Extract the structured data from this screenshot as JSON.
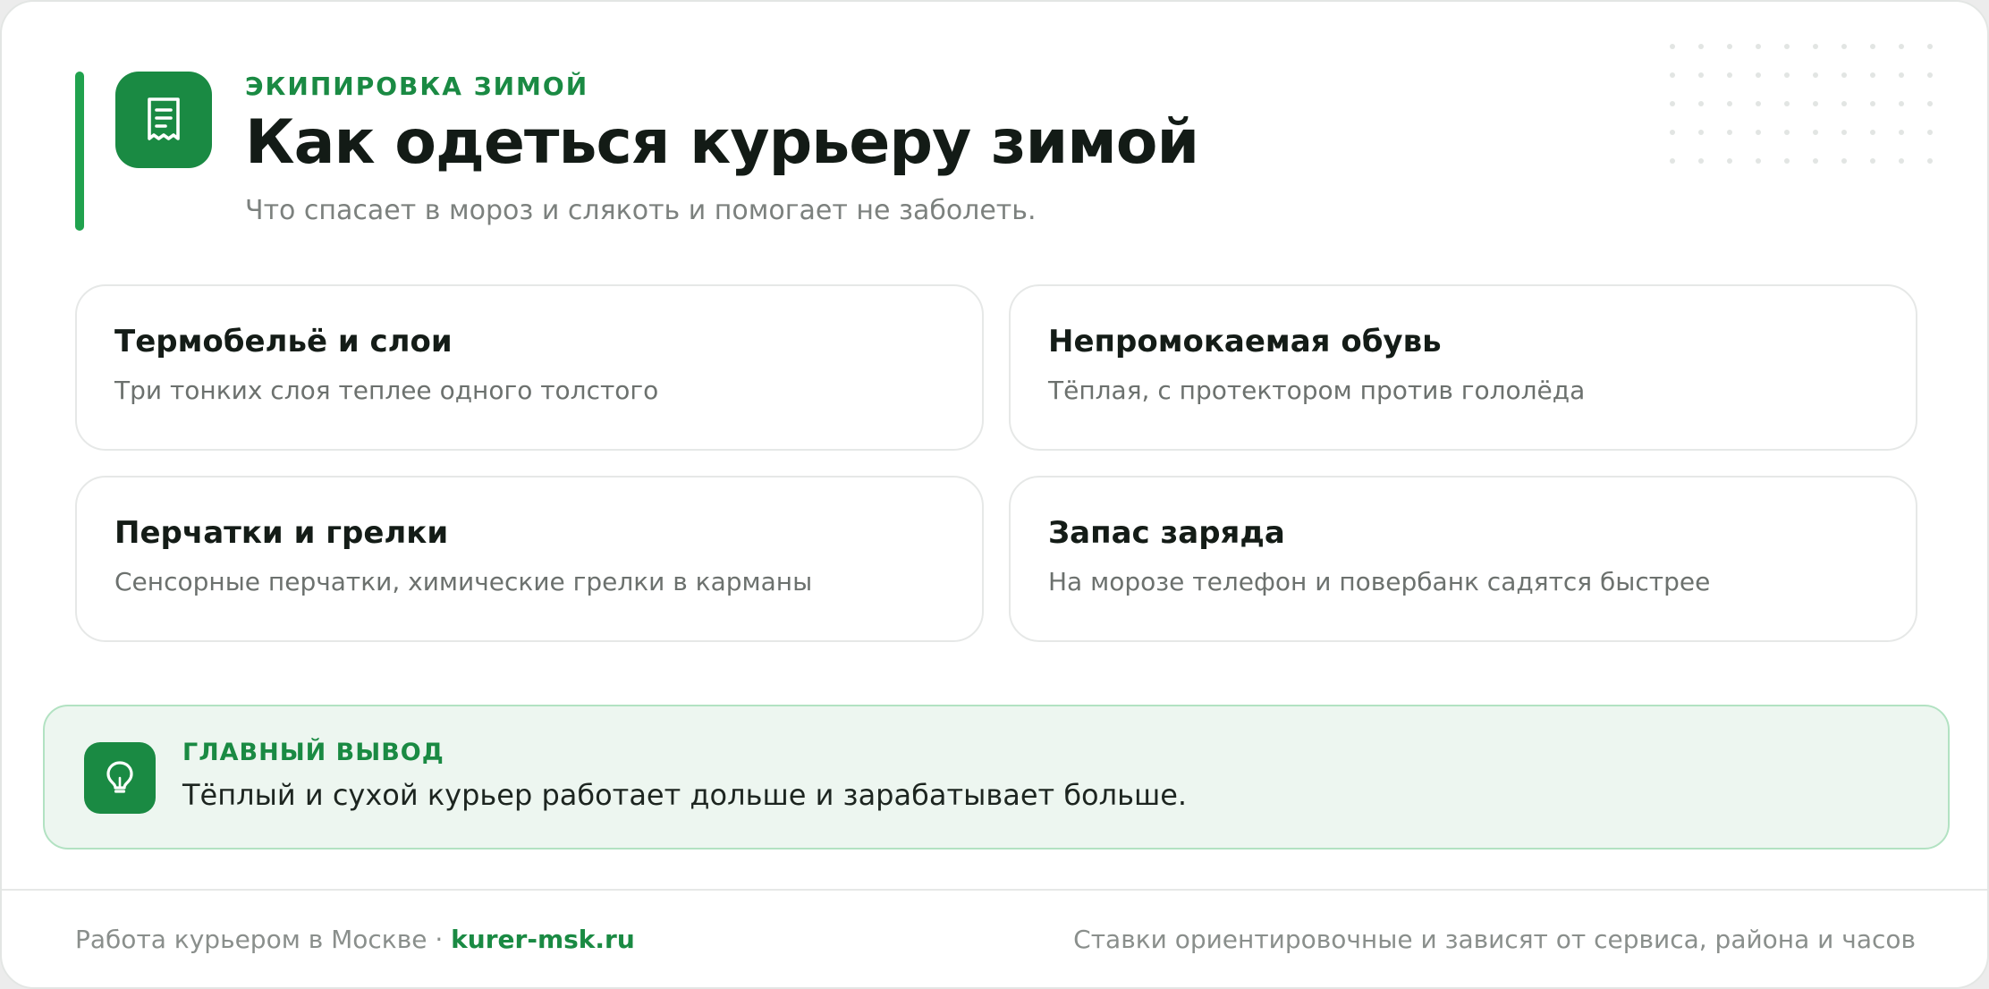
{
  "colors": {
    "brand_green": "#1a8a43",
    "accent_green": "#20a24e",
    "takeaway_background": "#edf6f0",
    "takeaway_border": "#b2e2c2"
  },
  "header": {
    "icon": "receipt-icon",
    "eyebrow": "ЭКИПИРОВКА ЗИМОЙ",
    "title": "Как одеться курьеру зимой",
    "subtitle": "Что спасает в мороз и слякоть и помогает не заболеть."
  },
  "tips": [
    {
      "title": "Термобельё и слои",
      "description": "Три тонких слоя теплее одного толстого"
    },
    {
      "title": "Непромокаемая обувь",
      "description": "Тёплая, с протектором против гололёда"
    },
    {
      "title": "Перчатки и грелки",
      "description": "Сенсорные перчатки, химические грелки в карманы"
    },
    {
      "title": "Запас заряда",
      "description": "На морозе телефон и повербанк садятся быстрее"
    }
  ],
  "takeaway": {
    "icon": "lightbulb-icon",
    "label": "ГЛАВНЫЙ ВЫВОД",
    "text": "Тёплый и сухой курьер работает дольше и зарабатывает больше."
  },
  "footer": {
    "left_text": "Работа курьером в Москве · ",
    "site": "kurer-msk.ru",
    "disclaimer": "Ставки ориентировочные и зависят от сервиса, района и часов"
  }
}
